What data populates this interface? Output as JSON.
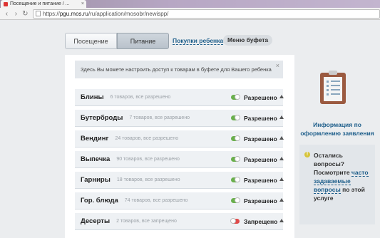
{
  "browser": {
    "tab_title": "Посещение и питание / ...",
    "tab_close": "×",
    "url_scheme": "https://",
    "url_host": "pgu.mos.ru",
    "url_path": "/ru/application/mosobr/newispp/"
  },
  "tabs": [
    {
      "label": "Посещение",
      "active": false
    },
    {
      "label": "Питание",
      "active": true
    }
  ],
  "purchases_link": "Покупки ребенка",
  "buffet_menu": "Меню буфета",
  "notice": {
    "text": "Здесь Вы можете настроить доступ к товарам в буфете для Вашего ребенка",
    "close": "×"
  },
  "categories": [
    {
      "name": "Блины",
      "meta": "6 товаров, все разрешено",
      "status": "Разрешено",
      "allowed": true
    },
    {
      "name": "Бутерброды",
      "meta": "7 товаров, все разрешено",
      "status": "Разрешено",
      "allowed": true
    },
    {
      "name": "Вендинг",
      "meta": "24 товаров, все разрешено",
      "status": "Разрешено",
      "allowed": true
    },
    {
      "name": "Выпечка",
      "meta": "90 товаров, все разрешено",
      "status": "Разрешено",
      "allowed": true
    },
    {
      "name": "Гарниры",
      "meta": "18 товаров, все разрешено",
      "status": "Разрешено",
      "allowed": true
    },
    {
      "name": "Гор. блюда",
      "meta": "74 товаров, все разрешено",
      "status": "Разрешено",
      "allowed": true
    },
    {
      "name": "Десерты",
      "meta": "2 товаров, все запрещено",
      "status": "Запрещено",
      "allowed": false
    }
  ],
  "sidebar": {
    "info_link_line1": "Информация по",
    "info_link_line2": "оформлению заявления",
    "faq_bang": "!",
    "faq_text1": "Остались вопросы? Посмотрите",
    "faq_link": "часто задаваемые вопросы",
    "faq_text2": "по этой услуге"
  },
  "colors": {
    "allowed": "#6ab04c",
    "forbidden": "#e04b4b",
    "link": "#1f5f8b"
  }
}
